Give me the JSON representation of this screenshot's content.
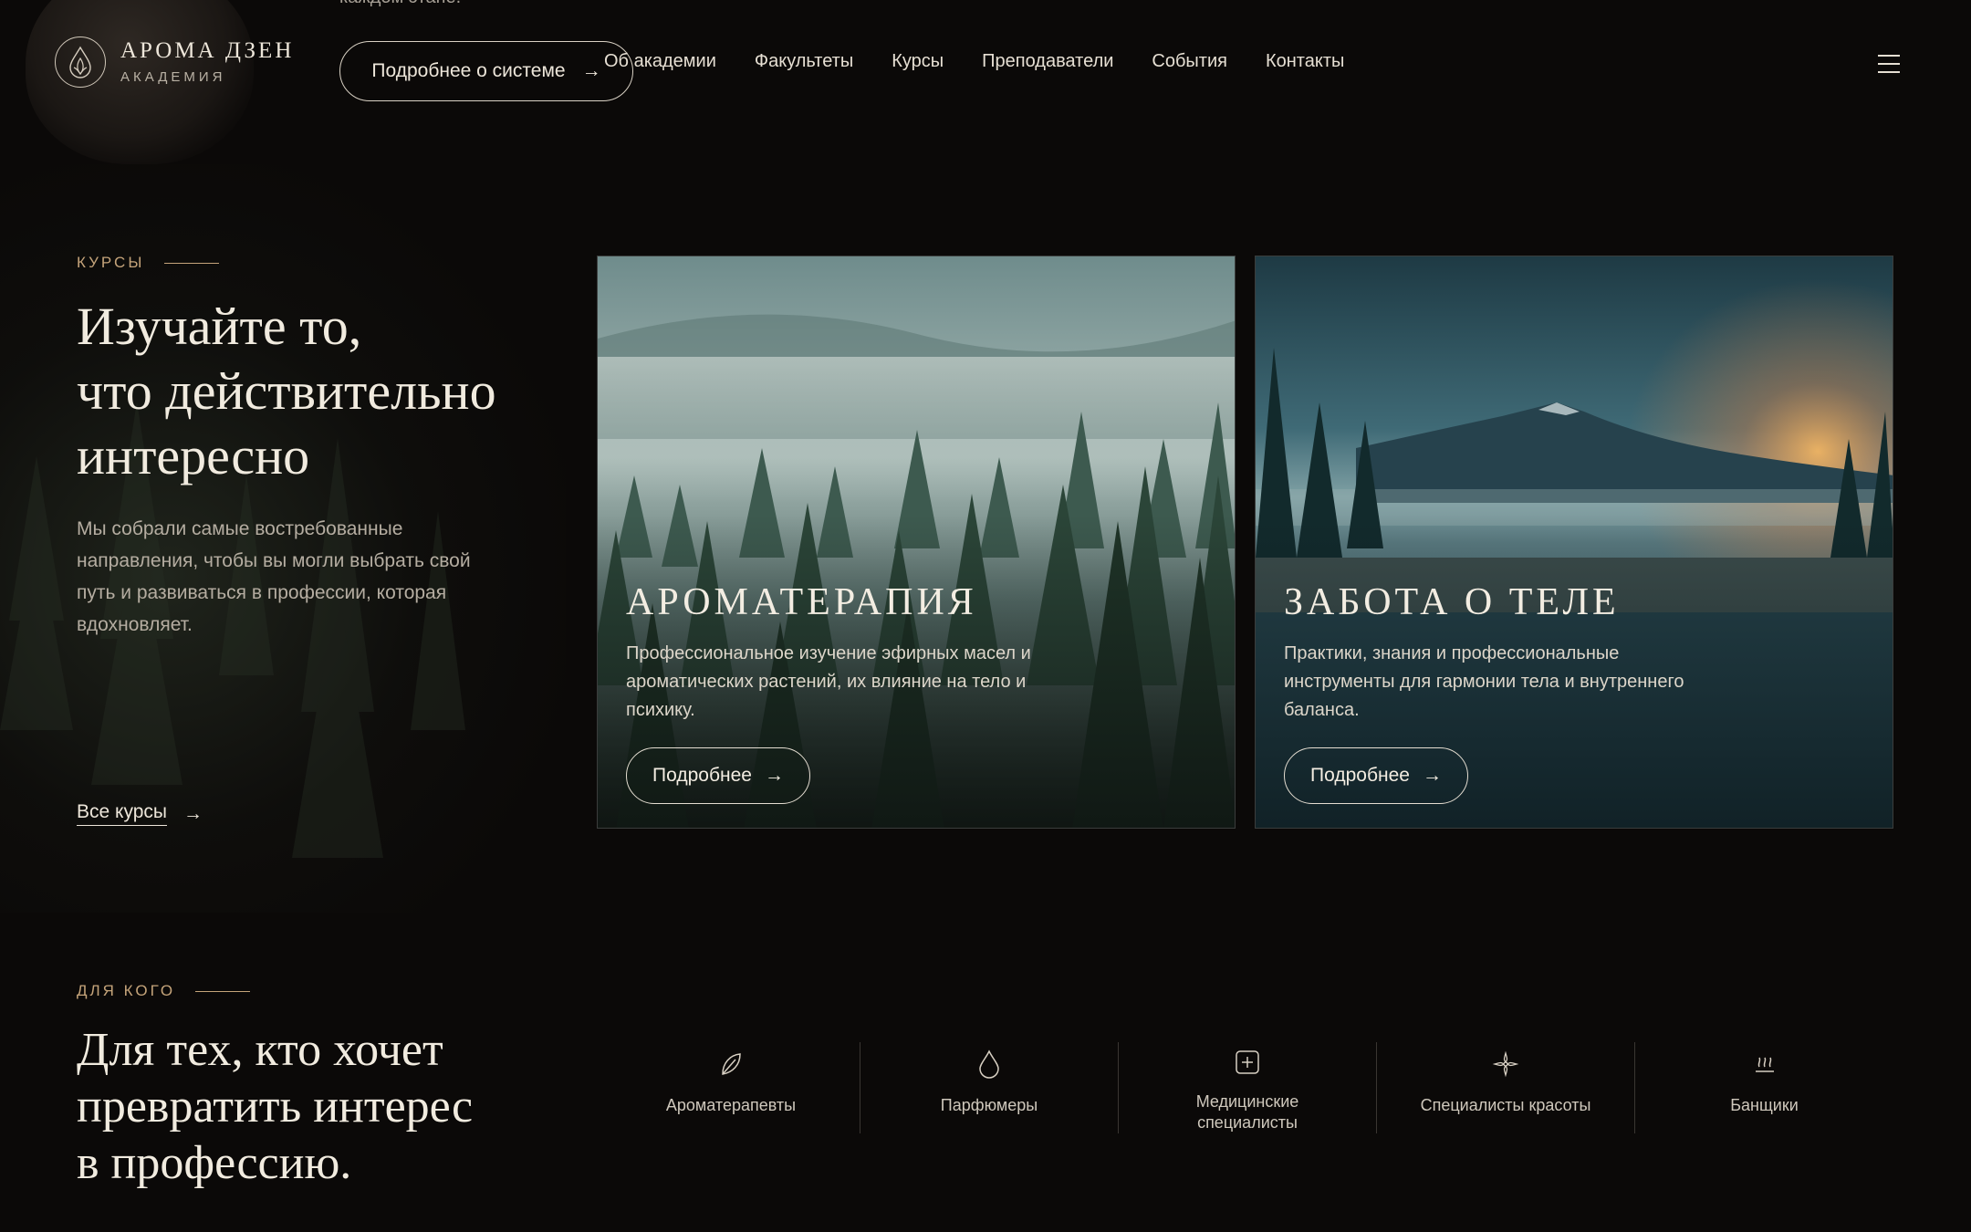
{
  "header": {
    "cut_text": "каждом этапе.",
    "logo_title": "АРОМА ДЗЕН",
    "logo_subtitle": "АКАДЕМИЯ",
    "system_button": "Подробнее о системе",
    "nav": [
      "Об академии",
      "Факультеты",
      "Курсы",
      "Преподаватели",
      "События",
      "Контакты"
    ],
    "menu_icon": "hamburger-icon"
  },
  "courses": {
    "eyebrow": "КУРСЫ",
    "title_lines": [
      "Изучайте то,",
      "что действительно",
      "интересно"
    ],
    "description": "Мы собрали самые востребованные направления, чтобы вы могли выбрать свой путь и развиваться в профессии, которая вдохновляет.",
    "all_courses": "Все курсы",
    "cards": [
      {
        "title": "АРОМАТЕРАПИЯ",
        "description": "Профессиональное изучение эфирных масел и ароматических растений, их влияние на тело и психику.",
        "button": "Подробнее"
      },
      {
        "title": "ЗАБОТА О ТЕЛЕ",
        "description": "Практики, знания и профессиональные инструменты для гармонии тела и внутреннего баланса.",
        "button": "Подробнее"
      }
    ]
  },
  "audience": {
    "eyebrow": "ДЛЯ КОГО",
    "title_lines": [
      "Для тех, кто хочет",
      "превратить интерес",
      "в профессию."
    ],
    "items": [
      {
        "label": "Ароматерапевты",
        "icon": "leaf-icon"
      },
      {
        "label": "Парфюмеры",
        "icon": "drop-icon"
      },
      {
        "label": "Медицинские специалисты",
        "icon": "medical-cross-icon"
      },
      {
        "label": "Специалисты красоты",
        "icon": "sparkle-flower-icon"
      },
      {
        "label": "Банщики",
        "icon": "steam-icon"
      }
    ]
  },
  "colors": {
    "background": "#0b0908",
    "accent_gold": "#c5a47a",
    "text": "#ede6da"
  }
}
